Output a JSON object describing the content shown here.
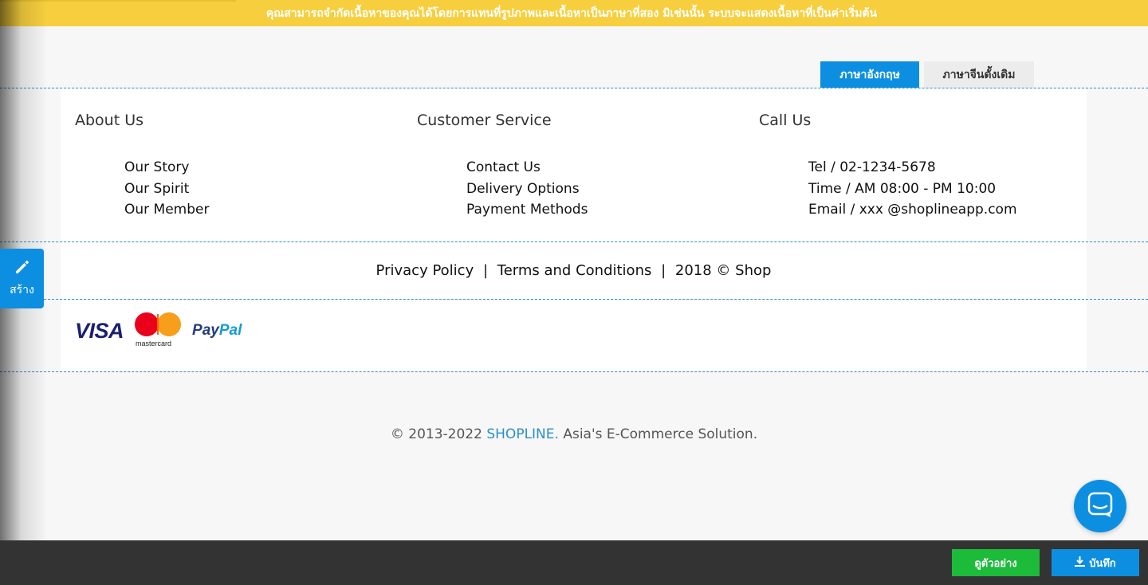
{
  "notice": {
    "text": "คุณสามารถจำกัดเนื้อหาของคุณได้โดยการแทนที่รูปภาพและเนื้อหาเป็นภาษาที่สอง มิเช่นนั้น ระบบจะแสดงเนื้อหาที่เป็นค่าเริ่มต้น"
  },
  "language_tabs": [
    {
      "label": "ภาษาอังกฤษ",
      "active": true
    },
    {
      "label": "ภาษาจีนดั้งเดิม",
      "active": false
    }
  ],
  "footer": {
    "columns": [
      {
        "title": "About Us",
        "items": [
          "Our Story",
          "Our Spirit",
          "Our Member"
        ]
      },
      {
        "title": "Customer Service",
        "items": [
          "Contact Us",
          "Delivery Options",
          "Payment Methods"
        ]
      },
      {
        "title": "Call Us",
        "items": [
          "Tel / 02-1234-5678",
          "Time / AM 08:00 - PM 10:00",
          "Email / xxx @shoplineapp.com"
        ]
      }
    ],
    "policy": {
      "privacy": "Privacy Policy",
      "separator": "|",
      "terms": "Terms and Conditions",
      "copyright": "2018 © Shop"
    },
    "payments": {
      "visa": "VISA",
      "mastercard": "mastercard",
      "paypal_a": "Pay",
      "paypal_b": "Pal"
    }
  },
  "copyright": {
    "prefix": "© 2013-2022",
    "brand": "SHOPLINE.",
    "suffix": "Asia's E-Commerce Solution."
  },
  "sidebar": {
    "create_label": "สร้าง",
    "create_icon": "pencil-icon"
  },
  "chat": {
    "icon": "chat-icon"
  },
  "bottom_bar": {
    "preview_label": "ดูตัวอย่าง",
    "save_label": "บันทึก",
    "save_icon": "download-icon"
  },
  "colors": {
    "accent": "#0d8fe1",
    "notice": "#f7cf3e",
    "preview": "#1dbb3a",
    "bottom_bar": "#333333",
    "brand_link": "#2a8fcf"
  }
}
